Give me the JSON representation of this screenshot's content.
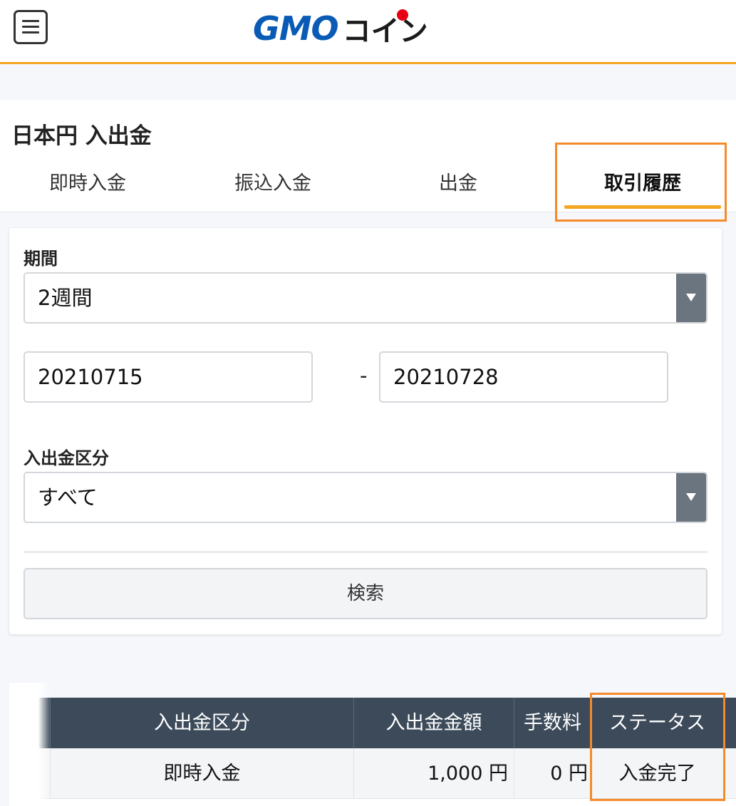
{
  "header": {
    "logo_text": "GMO",
    "logo_suffix": "コイン",
    "menu_icon": "hamburger-menu-icon"
  },
  "page": {
    "title": "日本円 入出金"
  },
  "tabs": [
    {
      "label": "即時入金",
      "active": false
    },
    {
      "label": "振込入金",
      "active": false
    },
    {
      "label": "出金",
      "active": false
    },
    {
      "label": "取引履歴",
      "active": true
    }
  ],
  "filter": {
    "period_label": "期間",
    "period_value": "2週間",
    "date_from": "20210715",
    "date_separator": "-",
    "date_to": "20210728",
    "type_label": "入出金区分",
    "type_value": "すべて",
    "search_label": "検索"
  },
  "table": {
    "headers": [
      "入出金区分",
      "入出金金額",
      "手数料",
      "ステータス"
    ],
    "rows": [
      {
        "type": "即時入金",
        "amount": "1,000 円",
        "fee": "0 円",
        "status": "入金完了"
      }
    ]
  },
  "colors": {
    "accent": "#f5a623",
    "highlight": "#f58a2a",
    "brand_blue": "#0a5bb5",
    "header_dark": "#3c4a5a"
  }
}
